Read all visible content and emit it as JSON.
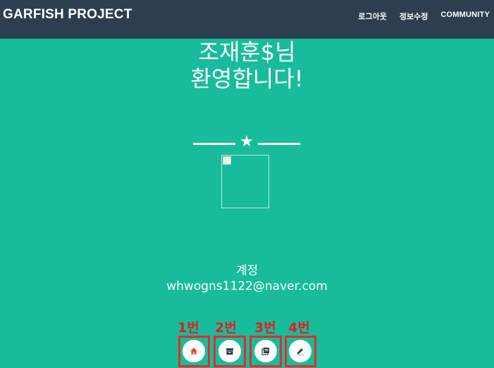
{
  "navbar": {
    "brand": "GARFISH PROJECT",
    "links": [
      "로그아웃",
      "정보수정",
      "COMMUNITY"
    ]
  },
  "hero": {
    "greeting_line1": "조재훈$님",
    "greeting_line2": "환영합니다!",
    "account_label": "계정",
    "account_email": "whwogns1122@naver.com"
  },
  "buttons": [
    {
      "annotation": "1번",
      "icon": "home-icon"
    },
    {
      "annotation": "2번",
      "icon": "archive-icon"
    },
    {
      "annotation": "3번",
      "icon": "book-icon"
    },
    {
      "annotation": "4번",
      "icon": "edit-icon"
    }
  ],
  "colors": {
    "navbar_bg": "#2c3e50",
    "hero_bg": "#18bc9c",
    "annotation_red": "#e02020",
    "icon_home": "#e74c3c",
    "icon_dark": "#2c3e50"
  }
}
